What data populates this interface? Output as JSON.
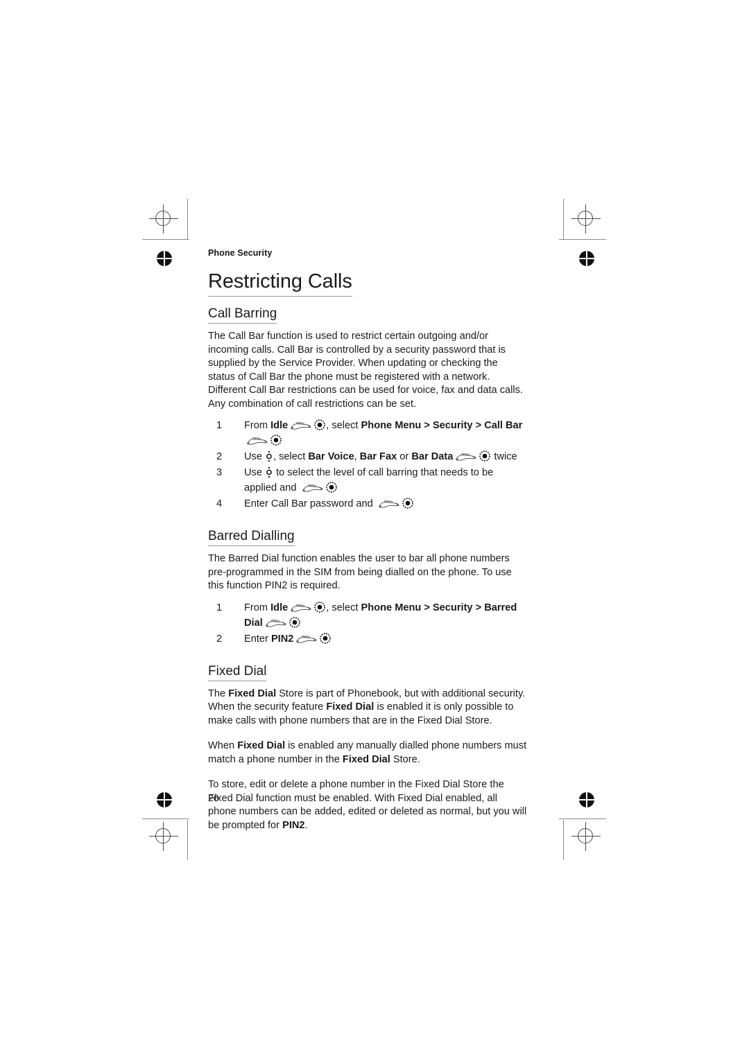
{
  "document": {
    "running_head": "Phone Security",
    "page_number": "26",
    "chapter_title": "Restricting Calls"
  },
  "sections": [
    {
      "id": "call-barring",
      "heading": "Call Barring",
      "paragraphs": [
        "The Call Bar function is used to restrict certain outgoing and/or incoming calls. Call Bar is controlled by a security password that is supplied by  the Service Provider. When updating or checking the status of Call Bar the phone must be registered with a network. Different Call Bar restrictions can be used for voice, fax and data calls. Any combination of call restrictions can be set."
      ],
      "steps": [
        {
          "number": "1",
          "parts": [
            {
              "type": "text",
              "text": "From "
            },
            {
              "type": "bold",
              "text": "Idle"
            },
            {
              "type": "icon",
              "icon": "hand-press-icon"
            },
            {
              "type": "icon",
              "icon": "select-key-icon"
            },
            {
              "type": "text",
              "text": ", select "
            },
            {
              "type": "bold",
              "text": "Phone Menu"
            },
            {
              "type": "bold",
              "text": " > "
            },
            {
              "type": "bold",
              "text": "Security"
            },
            {
              "type": "bold",
              "text": " > "
            },
            {
              "type": "bold",
              "text": "Call Bar"
            },
            {
              "type": "icon",
              "icon": "hand-press-icon"
            },
            {
              "type": "icon",
              "icon": "select-key-icon"
            }
          ]
        },
        {
          "number": "2",
          "parts": [
            {
              "type": "text",
              "text": "Use "
            },
            {
              "type": "icon",
              "icon": "navigation-updown-icon"
            },
            {
              "type": "text",
              "text": ", select  "
            },
            {
              "type": "bold",
              "text": "Bar Voice"
            },
            {
              "type": "text",
              "text": ", "
            },
            {
              "type": "bold",
              "text": "Bar Fax"
            },
            {
              "type": "text",
              "text": " or "
            },
            {
              "type": "bold",
              "text": "Bar Data"
            },
            {
              "type": "icon",
              "icon": "hand-press-icon"
            },
            {
              "type": "icon",
              "icon": "select-key-icon"
            },
            {
              "type": "text",
              "text": " twice"
            }
          ]
        },
        {
          "number": "3",
          "parts": [
            {
              "type": "text",
              "text": "Use "
            },
            {
              "type": "icon",
              "icon": "navigation-updown-icon"
            },
            {
              "type": "text",
              "text": " to select the level of call barring that needs to be applied and "
            },
            {
              "type": "icon",
              "icon": "hand-press-icon"
            },
            {
              "type": "icon",
              "icon": "select-key-icon"
            }
          ]
        },
        {
          "number": "4",
          "parts": [
            {
              "type": "text",
              "text": "Enter Call Bar password and "
            },
            {
              "type": "icon",
              "icon": "hand-press-icon"
            },
            {
              "type": "icon",
              "icon": "select-key-icon"
            }
          ]
        }
      ]
    },
    {
      "id": "barred-dialling",
      "heading": "Barred Dialling",
      "paragraphs": [
        "The Barred Dial function enables the user to bar all phone numbers pre-programmed in the SIM from being dialled on the phone. To use this function PIN2 is required."
      ],
      "steps": [
        {
          "number": "1",
          "parts": [
            {
              "type": "text",
              "text": "From "
            },
            {
              "type": "bold",
              "text": "Idle"
            },
            {
              "type": "icon",
              "icon": "hand-press-icon"
            },
            {
              "type": "icon",
              "icon": "select-key-icon"
            },
            {
              "type": "text",
              "text": ", select "
            },
            {
              "type": "bold",
              "text": "Phone Menu"
            },
            {
              "type": "bold",
              "text": " > "
            },
            {
              "type": "bold",
              "text": "Security"
            },
            {
              "type": "bold",
              "text": " > "
            },
            {
              "type": "bold",
              "text": "Barred Dial"
            },
            {
              "type": "icon",
              "icon": "hand-press-icon"
            },
            {
              "type": "icon",
              "icon": "select-key-icon"
            }
          ]
        },
        {
          "number": "2",
          "parts": [
            {
              "type": "text",
              "text": "Enter "
            },
            {
              "type": "bold",
              "text": "PIN2"
            },
            {
              "type": "icon",
              "icon": "hand-press-icon"
            },
            {
              "type": "icon",
              "icon": "select-key-icon"
            }
          ]
        }
      ]
    },
    {
      "id": "fixed-dial",
      "heading": "Fixed Dial",
      "paragraphs_rich": [
        [
          {
            "type": "text",
            "text": "The "
          },
          {
            "type": "bold",
            "text": "Fixed Dial"
          },
          {
            "type": "text",
            "text": " Store is part of Phonebook, but with additional security. When the security feature "
          },
          {
            "type": "bold",
            "text": "Fixed Dial"
          },
          {
            "type": "text",
            "text": " is enabled it is only possible to make calls with phone numbers that are in the Fixed Dial Store."
          }
        ],
        [
          {
            "type": "text",
            "text": "When "
          },
          {
            "type": "bold",
            "text": "Fixed Dial"
          },
          {
            "type": "text",
            "text": " is enabled any manually dialled phone numbers must match a phone number in the "
          },
          {
            "type": "bold",
            "text": "Fixed Dial"
          },
          {
            "type": "text",
            "text": " Store."
          }
        ],
        [
          {
            "type": "text",
            "text": "To store, edit or delete a phone number in the Fixed Dial Store the Fixed Dial function must be enabled. With Fixed Dial enabled, all phone numbers can be added, edited or deleted as normal, but you will be prompted for "
          },
          {
            "type": "bold",
            "text": "PIN2"
          },
          {
            "type": "text",
            "text": "."
          }
        ]
      ],
      "steps": []
    }
  ],
  "print_marks": {
    "registration_icon": "registration-target-icon",
    "bullseye_icon": "bullseye-mark-icon",
    "trim_line": "trim-line"
  },
  "colors": {
    "text": "#1a1a1a",
    "rule": "#9a9a9a",
    "mark": "#4a4a4a",
    "page_background": "#ffffff"
  }
}
